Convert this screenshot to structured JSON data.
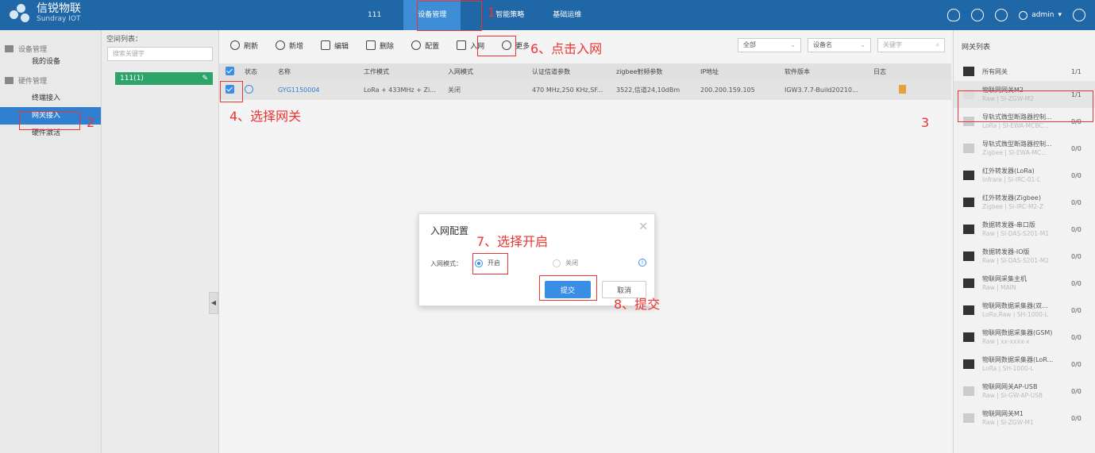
{
  "app": {
    "name_cn": "信锐物联",
    "name_en": "Sundray IOT"
  },
  "topnav": [
    "111",
    "设备管理",
    "智能策略",
    "基础运维"
  ],
  "user": {
    "name": "admin"
  },
  "sidebar": {
    "sections": [
      {
        "label": "设备管理",
        "items": [
          "我的设备"
        ]
      },
      {
        "label": "硬件管理",
        "items": [
          "终端接入",
          "网关接入",
          "硬件激活"
        ]
      }
    ]
  },
  "space": {
    "title": "空间列表：",
    "search_placeholder": "搜索关键字",
    "node": "111(1)"
  },
  "toolbar": [
    "刷新",
    "新增",
    "编辑",
    "删除",
    "配置",
    "入网",
    "更多"
  ],
  "filters": {
    "all": "全部",
    "field": "设备名",
    "keyword_placeholder": "关键字"
  },
  "table": {
    "headers": [
      "状态",
      "名称",
      "工作模式",
      "入网模式",
      "认证信道参数",
      "zigbee射频参数",
      "IP地址",
      "软件版本",
      "日志"
    ],
    "rows": [
      {
        "name": "GYG1150004",
        "mode": "LoRa + 433MHz + Zi...",
        "join": "关闭",
        "auth": "470 MHz,250 KHz,SF...",
        "zigbee": "3522,信道24,10dBm",
        "ip": "200.200.159.105",
        "version": "IGW3.7.7-Build20210..."
      }
    ]
  },
  "right_panel": {
    "title": "网关列表",
    "items": [
      {
        "name": "所有网关",
        "sub": "",
        "count": "1/1"
      },
      {
        "name": "物联网网关M2",
        "sub": "Raw | SI-ZGW-M2",
        "count": "1/1"
      },
      {
        "name": "导轨式微型断路器控制...",
        "sub": "LoRa | SI-EWA-MCBC...",
        "count": "0/0"
      },
      {
        "name": "导轨式微型断路器控制...",
        "sub": "Zigbee | SI-EWA-MC...",
        "count": "0/0"
      },
      {
        "name": "红外转发器(LoRa)",
        "sub": "Infrare | SI-IRC-01-L",
        "count": "0/0"
      },
      {
        "name": "红外转发器(Zigbee)",
        "sub": "Zigbee | SI-IRC-M2-Z",
        "count": "0/0"
      },
      {
        "name": "数据转发器-串口版",
        "sub": "Raw | SI-DAS-S201-M1",
        "count": "0/0"
      },
      {
        "name": "数据转发器-IO版",
        "sub": "Raw | SI-DAS-S201-M2",
        "count": "0/0"
      },
      {
        "name": "物联网采集主机",
        "sub": "Raw | MAIN",
        "count": "0/0"
      },
      {
        "name": "物联网数据采集器(双...",
        "sub": "LoRa,Raw | SH-1000-L",
        "count": "0/0"
      },
      {
        "name": "物联网数据采集器(GSM)",
        "sub": "Raw | xx-xxxx-x",
        "count": "0/0"
      },
      {
        "name": "物联网数据采集器(LoR...",
        "sub": "LoRa | SH-1000-L",
        "count": "0/0"
      },
      {
        "name": "物联网网关AP-USB",
        "sub": "Raw | SI-GW-AP-USB",
        "count": "0/0"
      },
      {
        "name": "物联网网关M1",
        "sub": "Raw | SI-ZGW-M1",
        "count": "0/0"
      }
    ]
  },
  "modal": {
    "title": "入网配置",
    "label": "入网模式：",
    "opt_on": "开启",
    "opt_off": "关闭",
    "info": "i",
    "submit": "提交",
    "cancel": "取消"
  },
  "annotations": [
    "1",
    "2",
    "3",
    "4、选择网关",
    "6、点击入网",
    "7、选择开启",
    "8、提交"
  ]
}
